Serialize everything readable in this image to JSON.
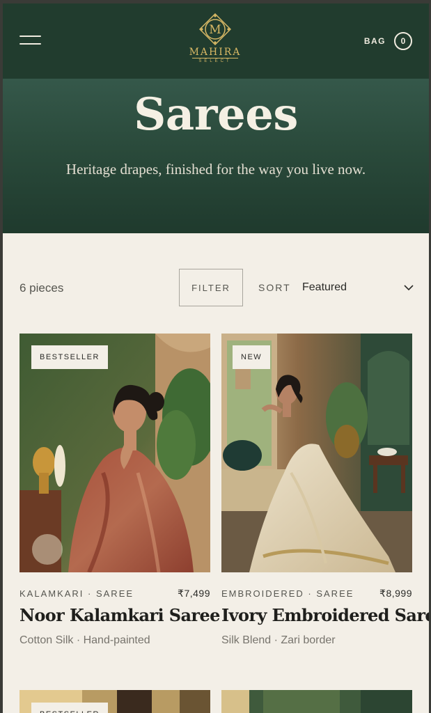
{
  "header": {
    "brand_initial": "M",
    "brand_name": "MAHIRA",
    "brand_sub": "SELECT",
    "bag_label": "BAG",
    "bag_count": "0"
  },
  "hero": {
    "title": "Sarees",
    "subtitle": "Heritage drapes, finished for the way you live now."
  },
  "toolbar": {
    "count": "6 pieces",
    "filter_label": "FILTER",
    "sort_label": "SORT",
    "sort_value": "Featured"
  },
  "products": [
    {
      "badge": "BESTSELLER",
      "category": "KALAMKARI · SAREE",
      "price": "₹7,499",
      "name": "Noor Kalamkari Saree",
      "details": "Cotton Silk · Hand-painted"
    },
    {
      "badge": "NEW",
      "category": "EMBROIDERED · SAREE",
      "price": "₹8,999",
      "name": "Ivory Embroidered Saree",
      "details": "Silk Blend · Zari border"
    },
    {
      "badge": "BESTSELLER"
    }
  ],
  "colors": {
    "header_bg": "#213c2e",
    "gold_accent": "#d8b865",
    "page_bg": "#f3efe7"
  },
  "icons": [
    "menu-icon",
    "monogram-logo",
    "chevron-down-icon"
  ]
}
